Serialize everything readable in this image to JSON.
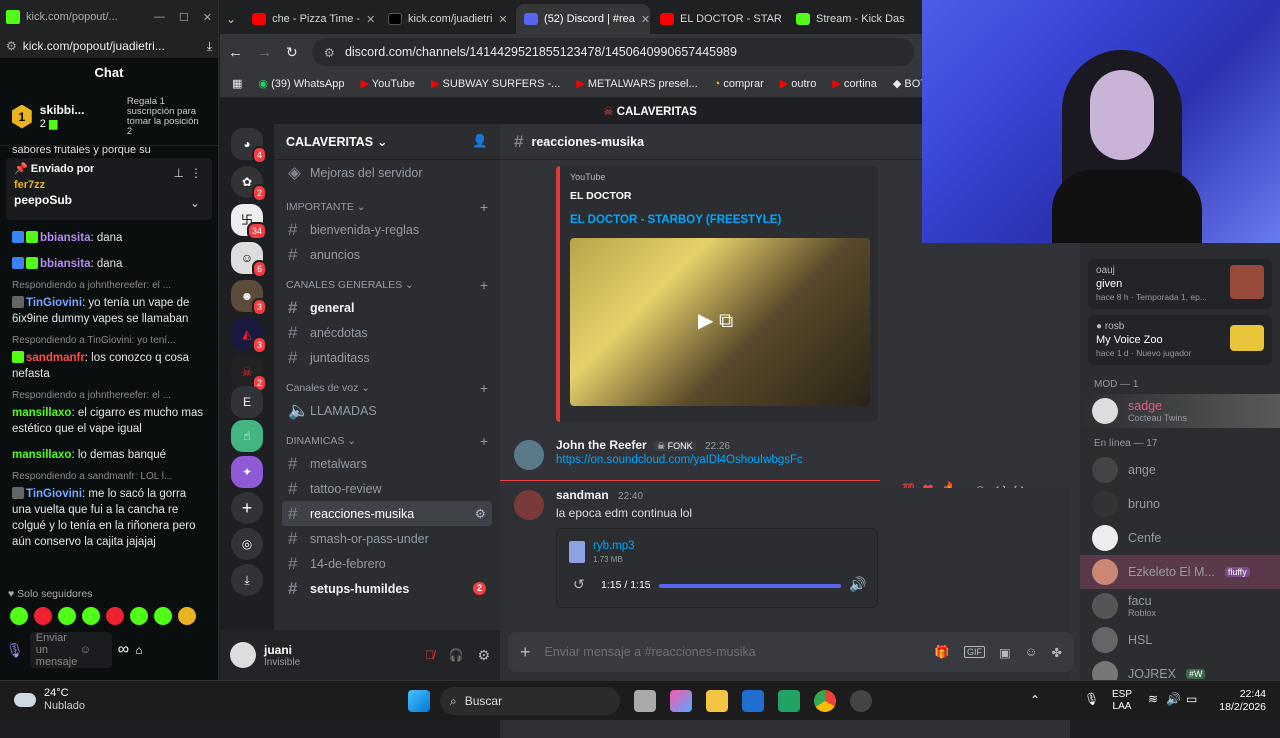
{
  "kick": {
    "window_url_short": "kick.com/popout/...",
    "url": "kick.com/popout/juadietri...",
    "chat_title": "Chat",
    "top_gifter": {
      "name": "skibbi...",
      "count": "2"
    },
    "gift_prompt": "Regala 1 suscripción para tomar la posición 2",
    "partial_text": "sabores frutales y porque su",
    "pinned": {
      "label": "Enviado por",
      "user": "fer7zz",
      "text": "peepoSub"
    },
    "messages": [
      {
        "type": "msg",
        "user": "bbiansita",
        "color": "#b48cf2",
        "text": ": dana"
      },
      {
        "type": "msg",
        "user": "bbiansita",
        "color": "#b48cf2",
        "text": ": dana"
      },
      {
        "type": "reply",
        "text": "Respondiendo a johnthereefer: el ..."
      },
      {
        "type": "msg",
        "user": "TinGiovini",
        "color": "#7aa7ff",
        "text": ": yo tenía un vape de 6ix9ine     dummy vapes se llamaban"
      },
      {
        "type": "reply",
        "text": "Respondiendo a TinGiovini: yo tení..."
      },
      {
        "type": "msg",
        "user": "sandmanfr",
        "color": "#ff4b4b",
        "text": ":               los conozco q cosa nefasta"
      },
      {
        "type": "reply",
        "text": "Respondiendo a johnthereefer: el ..."
      },
      {
        "type": "msg",
        "user": "mansillaxo",
        "color": "#53fc18",
        "text": ": el cigarro es mucho mas estético que el vape igual"
      },
      {
        "type": "msg",
        "user": "mansillaxo",
        "color": "#53fc18",
        "text": ": lo demas banqué"
      },
      {
        "type": "reply",
        "text": "Respondiendo a sandmanfr: LOL l..."
      },
      {
        "type": "msg",
        "user": "TinGiovini",
        "color": "#7aa7ff",
        "text": ": me lo sacó la gorra una vuelta que fui a la cancha re colgué y lo tenía en la riñonera pero aún conservo la cajita jajajaj"
      }
    ],
    "followers_only": "Solo seguidores",
    "input_placeholder": "Enviar un mensaje"
  },
  "browser": {
    "tabs": [
      {
        "label": "che - Pizza Time -",
        "color": "#ff0000"
      },
      {
        "label": "kick.com/juadietri",
        "color": "#000000"
      },
      {
        "label": "(52) Discord | #rea",
        "color": "#5865f2"
      },
      {
        "label": "EL DOCTOR - STAR",
        "color": "#ff0000"
      },
      {
        "label": "Stream - Kick Das",
        "color": "#53fc18"
      }
    ],
    "url": "discord.com/channels/1414429521855123478/1450640990657445989",
    "bookmarks": [
      "(39) WhatsApp",
      "YouTube",
      "SUBWAY SURFERS -...",
      "METALWARS presel...",
      "comprar",
      "outro",
      "cortina",
      "BOTR"
    ]
  },
  "discord": {
    "server_banner": "CALAVERITAS",
    "server_name": "CALAVERITAS",
    "guild_badges": [
      "4",
      "2",
      "34",
      "6",
      "3",
      "3",
      "2"
    ],
    "guild_letter": "E",
    "boost_item": "Mejoras del servidor",
    "categories": {
      "importante": "IMPORTANTE",
      "generales": "CANALES GENERALES",
      "voz": "Canales de voz",
      "dinamicas": "DINAMICAS"
    },
    "channels_importante": [
      "bienvenida-y-reglas",
      "anuncios"
    ],
    "channels_generales": [
      "general",
      "anécdotas",
      "juntaditass"
    ],
    "voice_channel": "LLAMADAS",
    "channels_dinamicas": [
      "metalwars",
      "tattoo-review",
      "reacciones-musika",
      "smash-or-pass-under",
      "14-de-febrero",
      "setups-humildes"
    ],
    "setups_badge": "2",
    "current_channel": "reacciones-musika",
    "embed": {
      "provider": "YouTube",
      "author": "EL DOCTOR",
      "title": "EL DOCTOR - STARBOY (FREESTYLE)"
    },
    "msg1": {
      "user": "John the Reefer",
      "tag": "FONK",
      "time": "22:26",
      "link": "https://on.soundcloud.com/yaIDl4OshouIwbgsFc"
    },
    "msg2": {
      "user": "sandman",
      "time": "22:40",
      "text": "la epoca edm continua lol"
    },
    "audio": {
      "file": "ryb.mp3",
      "size": "1.73 MB",
      "time": "1:15 / 1:15",
      "progress": 1.0
    },
    "composer_placeholder": "Enviar mensaje a #reacciones-musika",
    "user": {
      "name": "juani",
      "status": "Invisible"
    },
    "activities": [
      {
        "name": "given",
        "sub": "hace 8 h",
        "sub2": "Temporada 1, ep...",
        "user": "oauj"
      },
      {
        "name": "My Voice Zoo",
        "sub": "hace 1 d",
        "sub2": "Nuevo jugador",
        "user": "rosb"
      }
    ],
    "mod_header": "MOD — 1",
    "mod_member": {
      "name": "sadge",
      "sub": "Cocteau Twins"
    },
    "online_header": "En línea — 17",
    "online_members": [
      {
        "name": "ange",
        "sub": ""
      },
      {
        "name": "bruno",
        "sub": ""
      },
      {
        "name": "Cenfe",
        "sub": ""
      },
      {
        "name": "Ezkeleto El M...",
        "sub": "",
        "tag": "fluffy"
      },
      {
        "name": "facu",
        "sub": "Roblox"
      },
      {
        "name": "HSL",
        "sub": ""
      },
      {
        "name": "JOJREX",
        "sub": "",
        "tag": "#W"
      }
    ]
  },
  "taskbar": {
    "weather_temp": "24°C",
    "weather_desc": "Nublado",
    "search": "Buscar",
    "lang1": "ESP",
    "lang2": "LAA",
    "time": "22:44",
    "date": "18/2/2026"
  }
}
